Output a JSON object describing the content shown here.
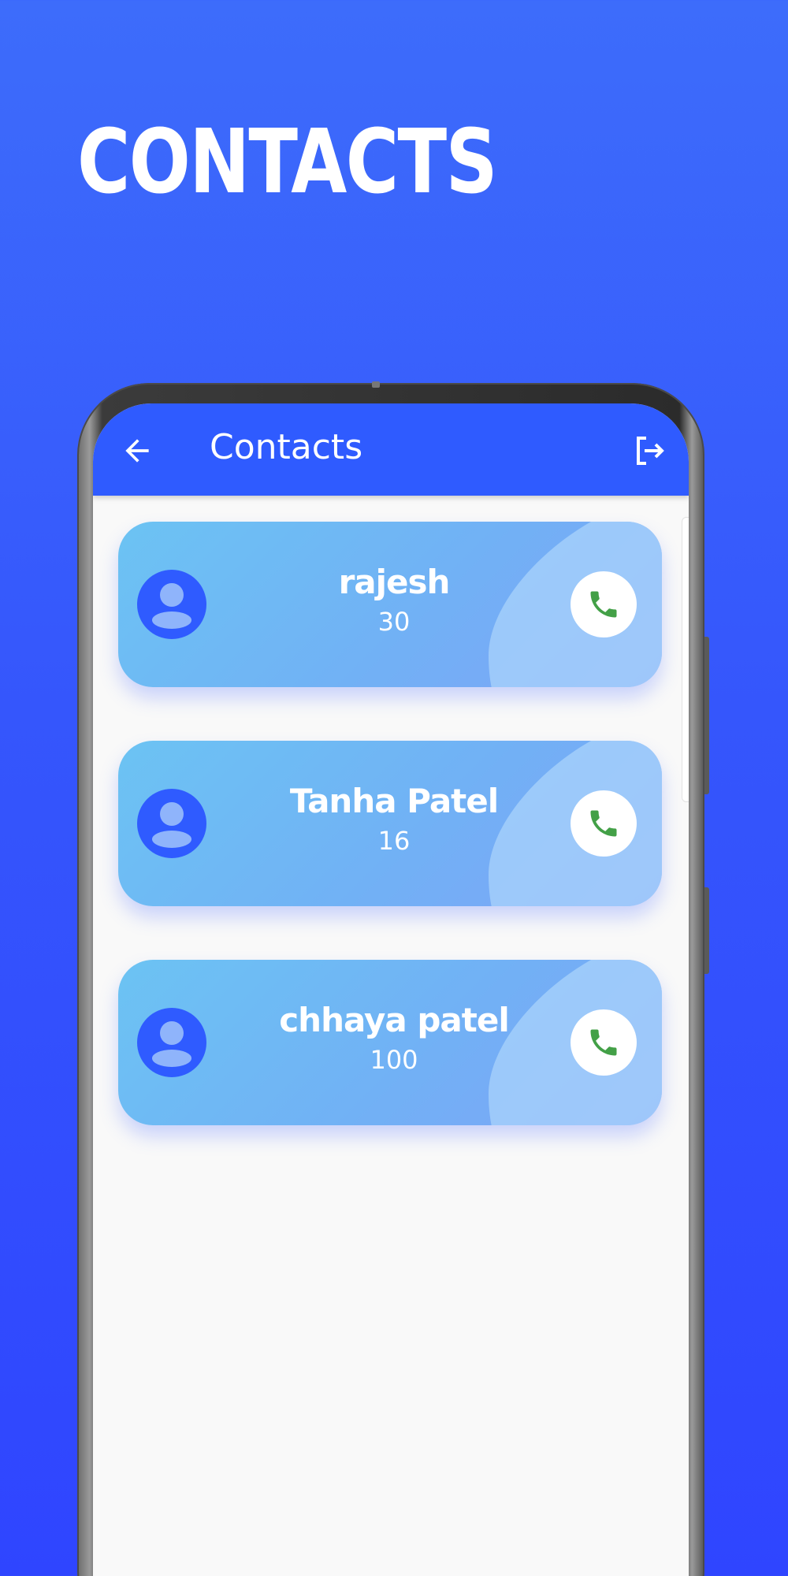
{
  "promo": {
    "title": "CONTACTS"
  },
  "appbar": {
    "title": "Contacts",
    "back_icon": "arrow-left-icon",
    "logout_icon": "logout-icon"
  },
  "contacts": [
    {
      "name": "rajesh",
      "age": "30"
    },
    {
      "name": "Tanha Patel",
      "age": "16"
    },
    {
      "name": "chhaya patel",
      "age": "100"
    }
  ],
  "colors": {
    "background": "#3556fc",
    "appbar": "#2f5bff",
    "avatar": "#2f5bff",
    "call_icon": "#43a047",
    "screen": "#f9f9f9"
  }
}
